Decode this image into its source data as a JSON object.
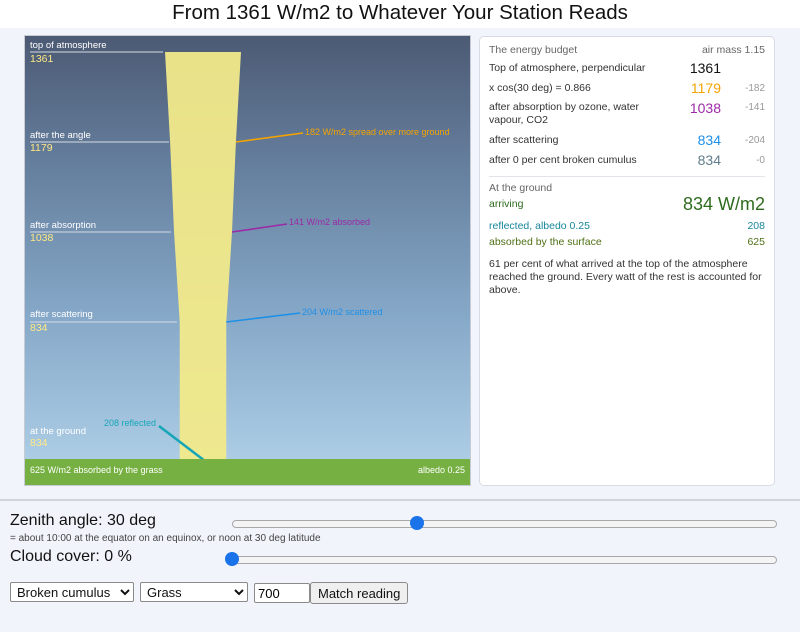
{
  "title": "From 1361 W/m2 to Whatever Your Station Reads",
  "viz": {
    "stages": [
      {
        "label": "top of atmosphere",
        "value": "1361"
      },
      {
        "label": "after the angle",
        "value": "1179"
      },
      {
        "label": "after absorption",
        "value": "1038"
      },
      {
        "label": "after scattering",
        "value": "834"
      },
      {
        "label": "at the ground",
        "value": "834"
      }
    ],
    "beam_values": [
      1361,
      1179,
      1038,
      834,
      834
    ],
    "notes": {
      "spread": "182 W/m2  spread over more ground",
      "absorbed": "141 W/m2  absorbed",
      "scattered": "204 W/m2  scattered",
      "reflected": "208 reflected"
    },
    "ground_absorbed": "625 W/m2 absorbed by the grass",
    "albedo": "albedo 0.25",
    "colors": {
      "beam": "#f1e98a",
      "spread": "#f5a300",
      "absorbed": "#9b2aa6",
      "scattered": "#1e8fe6",
      "reflected": "#17a6b8",
      "ground": "#76b042"
    }
  },
  "panel": {
    "heading": "The energy budget",
    "air_mass": "air mass 1.15",
    "rows": [
      {
        "label": "Top of atmosphere, perpendicular",
        "value": "1361",
        "delta": ""
      },
      {
        "label": "x cos(30 deg) = 0.866",
        "value": "1179",
        "delta": "-182"
      },
      {
        "label": "after absorption by ozone, water vapour, CO2",
        "value": "1038",
        "delta": "-141"
      },
      {
        "label": "after scattering",
        "value": "834",
        "delta": "-204"
      },
      {
        "label": "after 0 per cent broken cumulus",
        "value": "834",
        "delta": "-0"
      }
    ],
    "ground": {
      "heading": "At the ground",
      "arriving_label": "arriving",
      "arriving_value": "834 W/m2",
      "reflected_label": "reflected, albedo 0.25",
      "reflected_value": "208",
      "absorbed_label": "absorbed by the surface",
      "absorbed_value": "625"
    },
    "summary": "61 per cent of what arrived at the top of the atmosphere reached the ground. Every watt of the rest is accounted for above."
  },
  "controls": {
    "zenith_label": "Zenith angle:  30 deg",
    "zenith_hint": "= about 10:00 at the equator on an equinox, or noon at 30 deg latitude",
    "zenith_fraction": 0.34,
    "cloud_label": "Cloud cover:  0 %",
    "cloud_fraction": 0,
    "cloud_type": "Broken cumulus",
    "surface": "Grass",
    "reading_value": "700",
    "match_button": "Match reading"
  }
}
